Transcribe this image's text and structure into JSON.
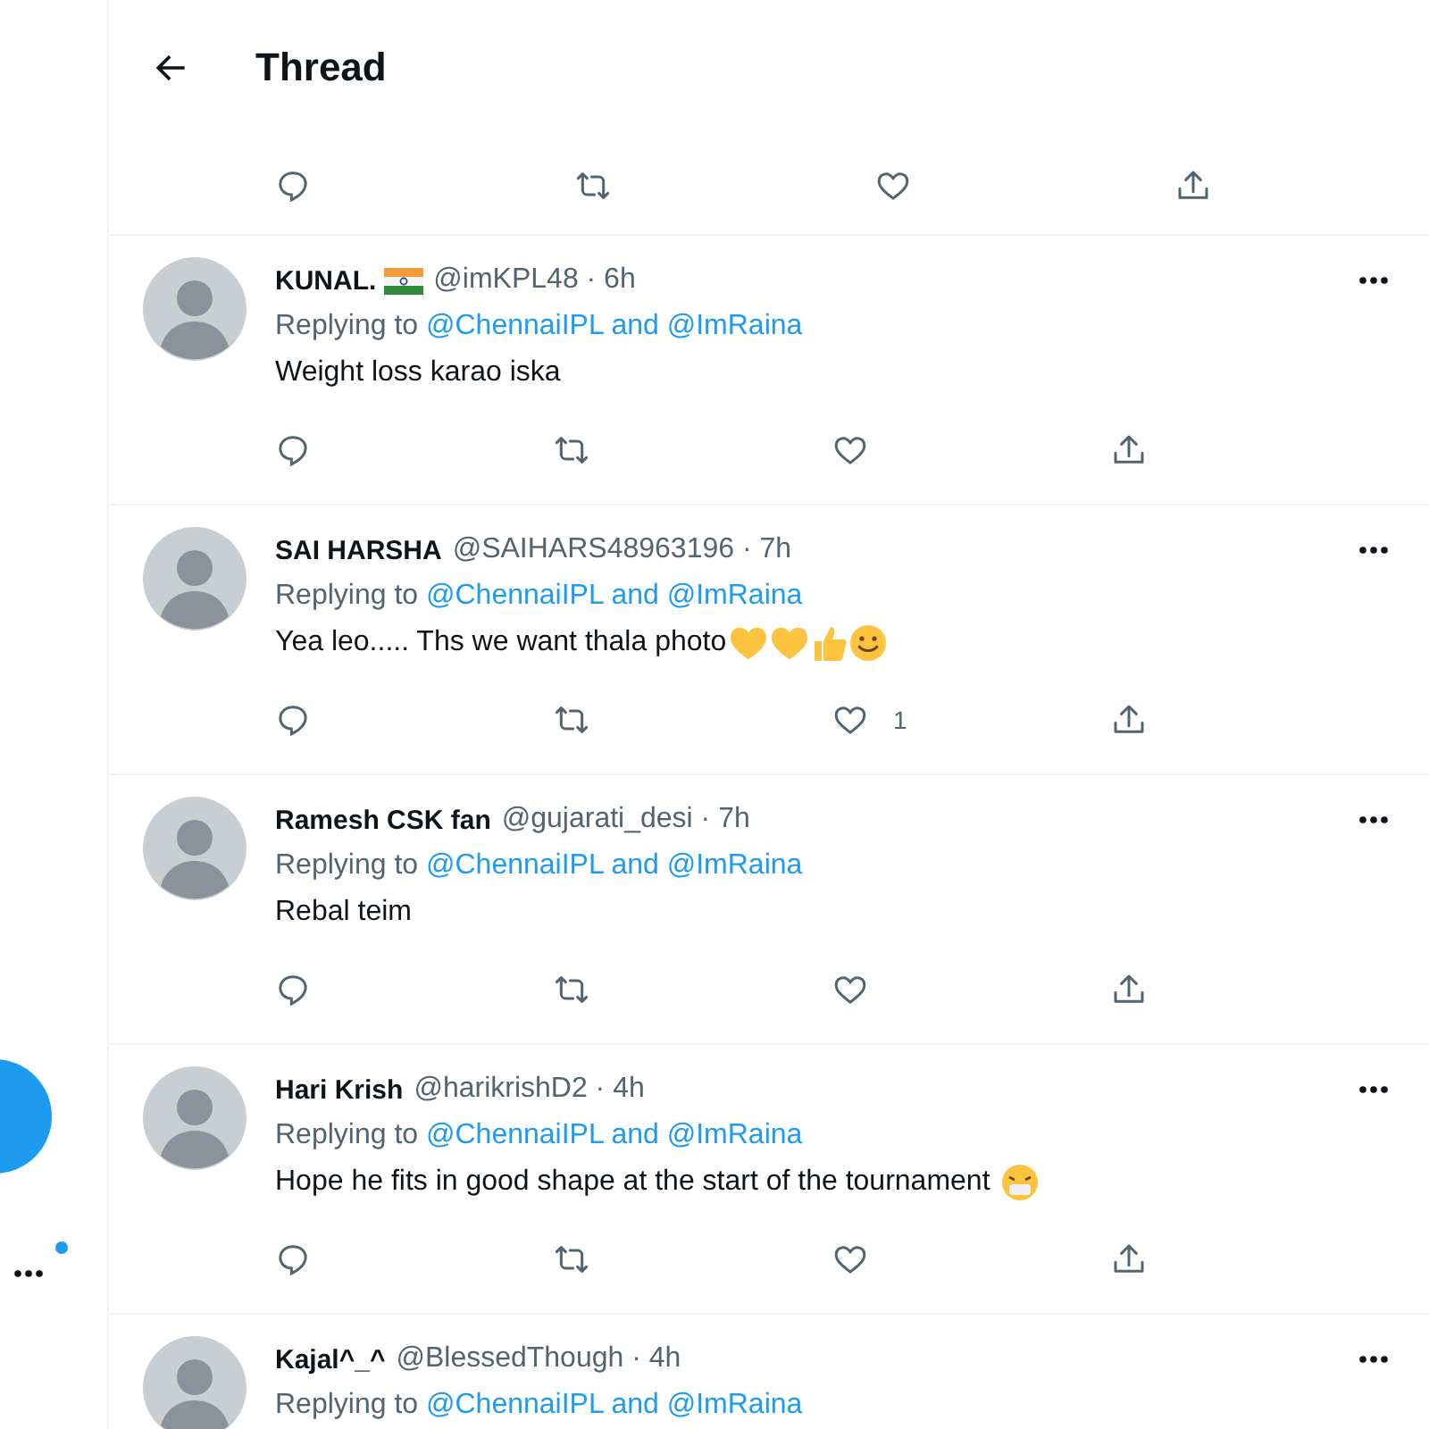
{
  "sidebar": {
    "has_unread": true
  },
  "header": {
    "title": "Thread"
  },
  "tweets": [
    {
      "name": "KUNAL.",
      "name_emojis": [
        {
          "kind": "flag"
        }
      ],
      "meta": "@imKPL48 · 6h",
      "reply_label": "Replying to",
      "reply_to": "@ChennaiIPL and @ImRaina",
      "text": "Weight loss karao iska"
    },
    {
      "name": "SAI HARSHA",
      "meta": "@SAIHARS48963196 · 7h",
      "reply_label": "Replying to",
      "reply_to": "@ChennaiIPL and @ImRaina",
      "text": "Yea leo..... Ths we want thala photo",
      "text_emojis": [
        {
          "kind": "heart"
        },
        {
          "kind": "heart"
        },
        {
          "kind": "thumbs-up"
        },
        {
          "kind": "smile"
        }
      ],
      "like_count": "1"
    },
    {
      "name": "Ramesh CSK fan",
      "meta": "@gujarati_desi · 7h",
      "reply_label": "Replying to",
      "reply_to": "@ChennaiIPL and @ImRaina",
      "text": "Rebal teim"
    },
    {
      "name": "Hari Krish",
      "meta": "@harikrishD2 · 4h",
      "reply_label": "Replying to",
      "reply_to": "@ChennaiIPL and @ImRaina",
      "text": "Hope he fits in good shape at the start of the tournament ",
      "text_emojis": [
        {
          "kind": "sick-face"
        }
      ]
    },
    {
      "name": "Kajal^_^",
      "meta": "@BlessedThough · 4h",
      "reply_label": "Replying to",
      "reply_to": "@ChennaiIPL and @ImRaina"
    }
  ]
}
